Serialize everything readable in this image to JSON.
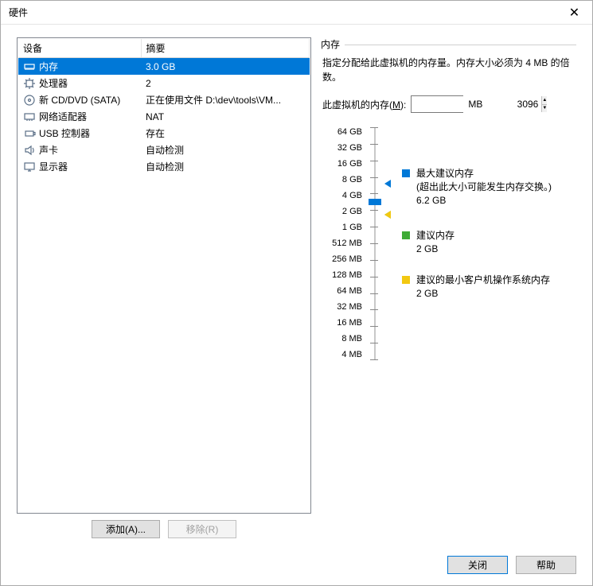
{
  "titlebar": {
    "title": "硬件"
  },
  "columns": {
    "device": "设备",
    "summary": "摘要"
  },
  "devices": [
    {
      "name": "内存",
      "summary": "3.0 GB",
      "icon": "memory",
      "selected": true
    },
    {
      "name": "处理器",
      "summary": "2",
      "icon": "cpu"
    },
    {
      "name": "新 CD/DVD (SATA)",
      "summary": "正在使用文件 D:\\dev\\tools\\VM...",
      "icon": "disc"
    },
    {
      "name": "网络适配器",
      "summary": "NAT",
      "icon": "nic"
    },
    {
      "name": "USB 控制器",
      "summary": "存在",
      "icon": "usb"
    },
    {
      "name": "声卡",
      "summary": "自动检测",
      "icon": "sound"
    },
    {
      "name": "显示器",
      "summary": "自动检测",
      "icon": "display"
    }
  ],
  "left_buttons": {
    "add": "添加(A)...",
    "remove": "移除(R)"
  },
  "right": {
    "group": "内存",
    "desc": "指定分配给此虚拟机的内存量。内存大小必须为 4 MB 的倍数。",
    "mem_label_pre": "此虚拟机的内存(",
    "mem_label_key": "M",
    "mem_label_post": "):",
    "mem_value": "3096",
    "mem_unit": "MB",
    "ticks": [
      "64 GB",
      "32 GB",
      "16 GB",
      "8 GB",
      "4 GB",
      "2 GB",
      "1 GB",
      "512 MB",
      "256 MB",
      "128 MB",
      "64 MB",
      "32 MB",
      "16 MB",
      "8 MB",
      "4 MB"
    ],
    "legend": {
      "max": {
        "title": "最大建议内存",
        "note": "(超出此大小可能发生内存交换。)",
        "value": "6.2 GB"
      },
      "rec": {
        "title": "建议内存",
        "value": "2 GB"
      },
      "min": {
        "title": "建议的最小客户机操作系统内存",
        "value": "2 GB"
      }
    }
  },
  "footer": {
    "close": "关闭",
    "help": "帮助"
  }
}
